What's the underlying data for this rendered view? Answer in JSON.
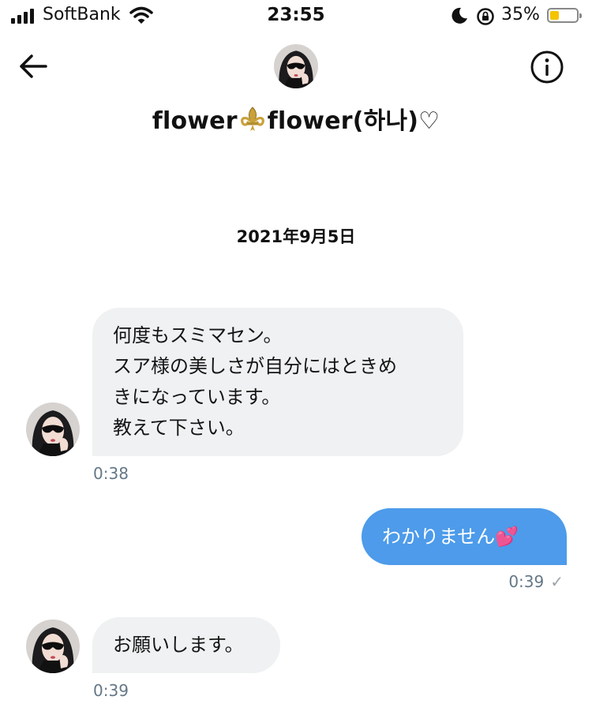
{
  "status_bar": {
    "carrier": "SoftBank",
    "time": "23:55",
    "battery_percent": "35%",
    "battery_level": 0.35,
    "battery_color": "#f5c400"
  },
  "header": {
    "back_icon": "arrow-left-icon",
    "info_icon": "info-circle-icon",
    "name_part1": "flower",
    "name_symbol": "⚜️",
    "name_part2": "flower(하나)♡"
  },
  "conversation": {
    "date": "2021年9月5日",
    "messages": [
      {
        "direction": "incoming",
        "lines": [
          "何度もスミマセン。",
          "スア様の美しさが自分にはときめ",
          "きになっています。",
          "教えて下さい。"
        ],
        "time": "0:38"
      },
      {
        "direction": "outgoing",
        "text": "わかりません💕",
        "time": "0:39",
        "status_icon": "check-icon"
      },
      {
        "direction": "incoming",
        "text": "お願いします。",
        "time": "0:39"
      }
    ]
  },
  "colors": {
    "incoming_bubble": "#eff1f2",
    "outgoing_bubble": "#4d9bea",
    "timestamp": "#657786"
  }
}
